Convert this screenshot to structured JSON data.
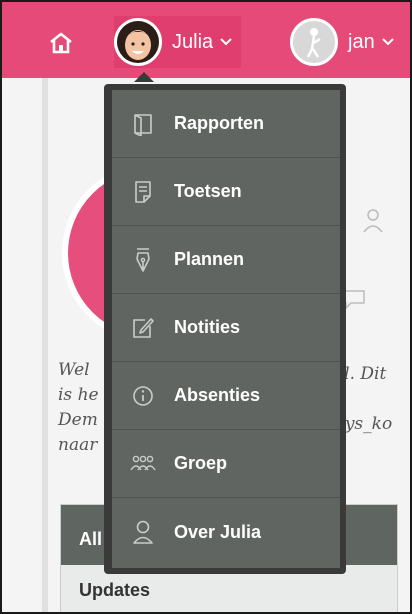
{
  "header": {
    "current_user": "Julia",
    "other_user": "jan"
  },
  "menu": {
    "items": [
      {
        "label": "Rapporten",
        "icon": "book-icon"
      },
      {
        "label": "Toetsen",
        "icon": "document-icon"
      },
      {
        "label": "Plannen",
        "icon": "pen-nib-icon"
      },
      {
        "label": "Notities",
        "icon": "edit-note-icon"
      },
      {
        "label": "Absenties",
        "icon": "info-icon"
      },
      {
        "label": "Groep",
        "icon": "group-icon"
      },
      {
        "label": "Over Julia",
        "icon": "person-icon"
      }
    ]
  },
  "welcome": {
    "lines": [
      "Wel",
      "is he",
      "Dem",
      "naar"
    ],
    "right_lines": [
      "al. Dit",
      "",
      "5ys_ko",
      ""
    ]
  },
  "card": {
    "title": "All",
    "subtitle": "Updates"
  },
  "colors": {
    "brand": "#e54a79",
    "menu_bg": "#616561",
    "menu_border": "#3a3a3a"
  }
}
